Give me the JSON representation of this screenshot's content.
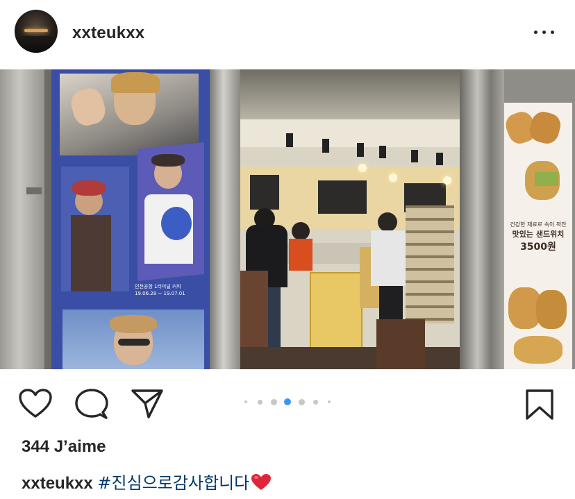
{
  "post": {
    "username": "xxteukxx",
    "more_icon": "ellipsis-icon",
    "likes_text": "344 J’aime",
    "caption_username": "xxteukxx",
    "caption_text": "#진심으로감사합니다",
    "caption_emoji": "❤️"
  },
  "photo": {
    "poster_text": "인천공항 1터미널 커피",
    "poster_date": "19.06.28 ~ 19.07.01",
    "sandwich_poster_line1": "건강한 재료로 속이 꽉찬",
    "sandwich_poster_line2": "맛있는 샌드위치",
    "sandwich_poster_price": "3500원"
  },
  "actions": {
    "like_icon": "heart-icon",
    "comment_icon": "comment-bubble-icon",
    "share_icon": "paper-plane-icon",
    "save_icon": "bookmark-icon"
  },
  "carousel": {
    "total": 7,
    "active_index": 3
  },
  "colors": {
    "text": "#262626",
    "active_dot": "#3897f0",
    "inactive_dot": "#c7c7c7",
    "poster_blue": "#3a4ea6",
    "heart_red": "#e0253a"
  }
}
